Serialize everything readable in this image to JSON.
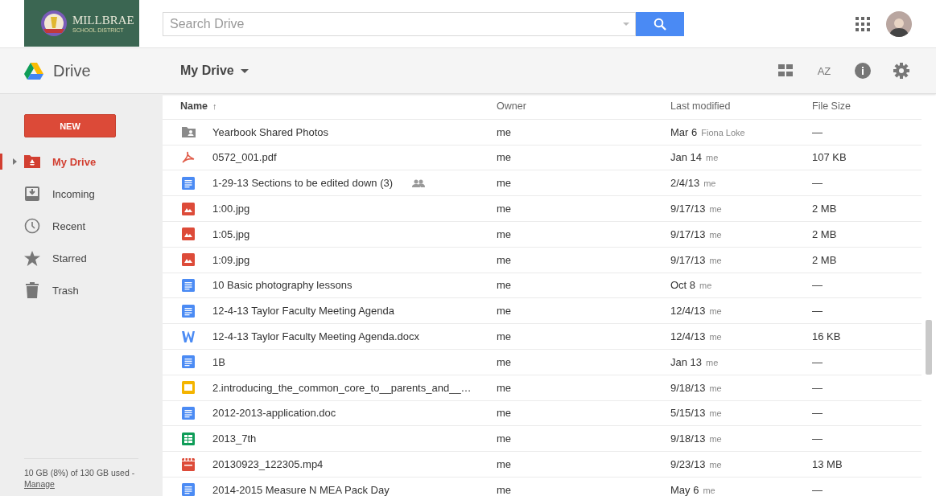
{
  "header": {
    "logo": {
      "title": "MILLBRAE",
      "subtitle": "SCHOOL DISTRICT"
    },
    "search": {
      "placeholder": "Search Drive"
    }
  },
  "toolbar": {
    "app_name": "Drive",
    "location": "My Drive",
    "sort_label": "AZ"
  },
  "sidebar": {
    "new_button": "NEW",
    "items": [
      {
        "label": "My Drive",
        "kind": "drive",
        "selected": true
      },
      {
        "label": "Incoming",
        "kind": "incoming",
        "selected": false
      },
      {
        "label": "Recent",
        "kind": "recent",
        "selected": false
      },
      {
        "label": "Starred",
        "kind": "starred",
        "selected": false
      },
      {
        "label": "Trash",
        "kind": "trash",
        "selected": false
      }
    ],
    "storage": {
      "text": "10 GB (8%) of 130 GB used -",
      "link": "Manage"
    }
  },
  "table": {
    "columns": [
      {
        "label": "Name",
        "sort": "↑"
      },
      {
        "label": "Owner"
      },
      {
        "label": "Last modified"
      },
      {
        "label": "File Size"
      }
    ],
    "rows": [
      {
        "kind": "shared-folder",
        "name": "Yearbook Shared Photos",
        "shared": false,
        "owner": "me",
        "date": "Mar 6",
        "by": "Fiona Loke",
        "size": "—"
      },
      {
        "kind": "pdf",
        "name": "0572_001.pdf",
        "shared": false,
        "owner": "me",
        "date": "Jan 14",
        "by": "me",
        "size": "107 KB"
      },
      {
        "kind": "doc",
        "name": "1-29-13 Sections to be edited down (3)",
        "shared": true,
        "owner": "me",
        "date": "2/4/13",
        "by": "me",
        "size": "—"
      },
      {
        "kind": "image",
        "name": "1:00.jpg",
        "shared": false,
        "owner": "me",
        "date": "9/17/13",
        "by": "me",
        "size": "2 MB"
      },
      {
        "kind": "image",
        "name": "1:05.jpg",
        "shared": false,
        "owner": "me",
        "date": "9/17/13",
        "by": "me",
        "size": "2 MB"
      },
      {
        "kind": "image",
        "name": "1:09.jpg",
        "shared": false,
        "owner": "me",
        "date": "9/17/13",
        "by": "me",
        "size": "2 MB"
      },
      {
        "kind": "doc",
        "name": "10 Basic photography lessons",
        "shared": false,
        "owner": "me",
        "date": "Oct 8",
        "by": "me",
        "size": "—"
      },
      {
        "kind": "doc",
        "name": "12-4-13 Taylor Faculty Meeting Agenda",
        "shared": false,
        "owner": "me",
        "date": "12/4/13",
        "by": "me",
        "size": "—"
      },
      {
        "kind": "word",
        "name": "12-4-13 Taylor Faculty Meeting Agenda.docx",
        "shared": false,
        "owner": "me",
        "date": "12/4/13",
        "by": "me",
        "size": "16 KB"
      },
      {
        "kind": "doc",
        "name": "1B",
        "shared": false,
        "owner": "me",
        "date": "Jan 13",
        "by": "me",
        "size": "—"
      },
      {
        "kind": "slides",
        "name": "2.introducing_the_common_core_to__parents_and__…",
        "shared": false,
        "owner": "me",
        "date": "9/18/13",
        "by": "me",
        "size": "—"
      },
      {
        "kind": "doc",
        "name": "2012-2013-application.doc",
        "shared": false,
        "owner": "me",
        "date": "5/15/13",
        "by": "me",
        "size": "—"
      },
      {
        "kind": "sheet",
        "name": "2013_7th",
        "shared": false,
        "owner": "me",
        "date": "9/18/13",
        "by": "me",
        "size": "—"
      },
      {
        "kind": "video",
        "name": "20130923_122305.mp4",
        "shared": false,
        "owner": "me",
        "date": "9/23/13",
        "by": "me",
        "size": "13 MB"
      },
      {
        "kind": "doc",
        "name": "2014-2015 Measure N MEA Pack Day",
        "shared": false,
        "owner": "me",
        "date": "May 6",
        "by": "me",
        "size": "—"
      }
    ]
  }
}
